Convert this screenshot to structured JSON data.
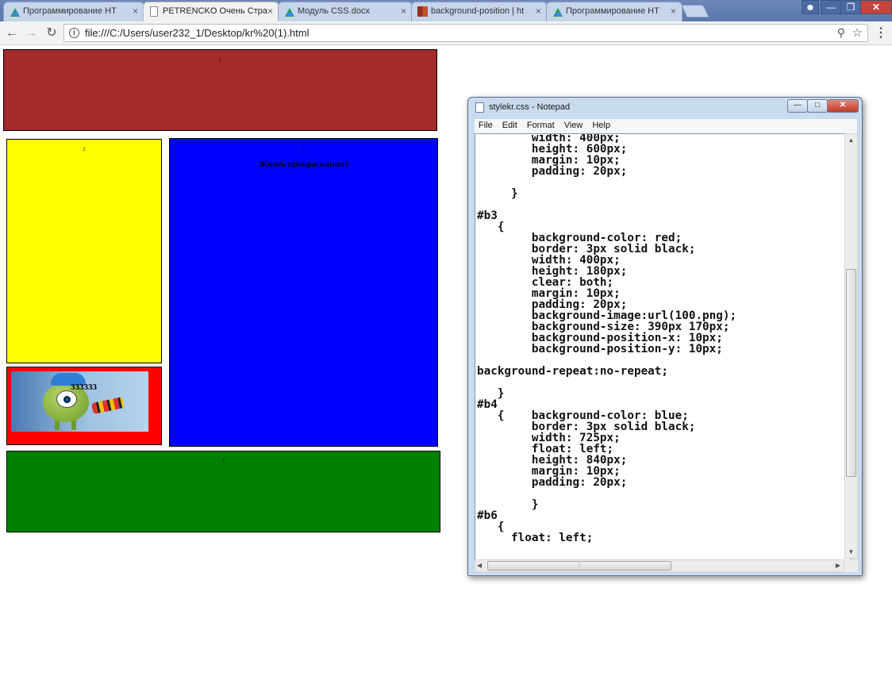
{
  "browser": {
    "tabs": [
      {
        "title": "Программирование HT",
        "icon": "drive-icon"
      },
      {
        "title": "PETRENCKO Очень Стра",
        "icon": "page-icon"
      },
      {
        "title": "Модуль CSS.docx",
        "icon": "drive-icon"
      },
      {
        "title": "background-position | ht",
        "icon": "mdn-icon"
      },
      {
        "title": "Программирование HT",
        "icon": "drive-icon"
      }
    ],
    "active_tab": 1,
    "url": "file:///C:/Users/user232_1/Desktop/kr%20(1).html"
  },
  "page": {
    "box1_label": "1",
    "box2_label": "2",
    "box3_label": "333333",
    "box4_label": "4",
    "box4_text": "Жизнь прекрасна(нет)",
    "box5_label": "5",
    "colors": {
      "b1": "#a52a2a",
      "b2": "#ffff00",
      "b3": "#ff0000",
      "b4": "#0000ff",
      "b5": "#008000"
    }
  },
  "notepad": {
    "title": "stylekr.css - Notepad",
    "menu": [
      "File",
      "Edit",
      "Format",
      "View",
      "Help"
    ],
    "content": "        width: 400px;\n        height: 600px;\n        margin: 10px;\n        padding: 20px;\n\n     }\n\n#b3\n   {\n        background-color: red;\n        border: 3px solid black;\n        width: 400px;\n        height: 180px;\n        clear: both;\n        margin: 10px;\n        padding: 20px;\n        background-image:url(100.png);\n        background-size: 390px 170px;\n        background-position-x: 10px;\n        background-position-y: 10px;\n\nbackground-repeat:no-repeat;\n\n   }\n#b4\n   {    background-color: blue;\n        border: 3px solid black;\n        width: 725px;\n        float: left;\n        height: 840px;\n        margin: 10px;\n        padding: 20px;\n\n        }\n#b6\n   {\n     float: left;"
  }
}
